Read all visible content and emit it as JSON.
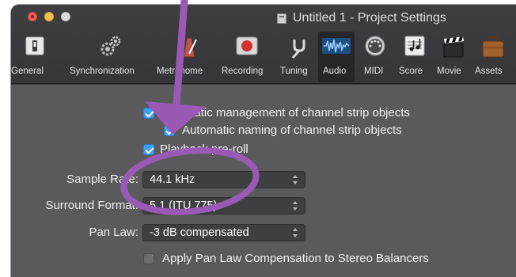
{
  "window": {
    "title": "Untitled 1 - Project Settings"
  },
  "toolbar": {
    "items": [
      {
        "label": "General",
        "icon": "general-icon"
      },
      {
        "label": "Synchronization",
        "icon": "gears-icon"
      },
      {
        "label": "Metronome",
        "icon": "metronome-icon"
      },
      {
        "label": "Recording",
        "icon": "record-icon"
      },
      {
        "label": "Tuning",
        "icon": "tuning-fork-icon"
      },
      {
        "label": "Audio",
        "icon": "waveform-icon"
      },
      {
        "label": "MIDI",
        "icon": "midi-connector-icon"
      },
      {
        "label": "Score",
        "icon": "score-icon"
      },
      {
        "label": "Movie",
        "icon": "clapperboard-icon"
      },
      {
        "label": "Assets",
        "icon": "briefcase-icon"
      }
    ],
    "active": "Audio"
  },
  "audio": {
    "auto_management_label": "Automatic management of channel strip objects",
    "auto_naming_label": "Automatic naming of channel strip objects",
    "playback_preroll_label": "Playback pre-roll",
    "sample_rate_label": "Sample Rate:",
    "sample_rate_value": "44.1 kHz",
    "surround_format_label": "Surround Format:",
    "surround_format_value": "5.1 (ITU 775)",
    "pan_law_label": "Pan Law:",
    "pan_law_value": "-3 dB compensated",
    "apply_pan_law_label": "Apply Pan Law Compensation to Stereo Balancers"
  },
  "annotation": {
    "color": "#9b59b6"
  }
}
